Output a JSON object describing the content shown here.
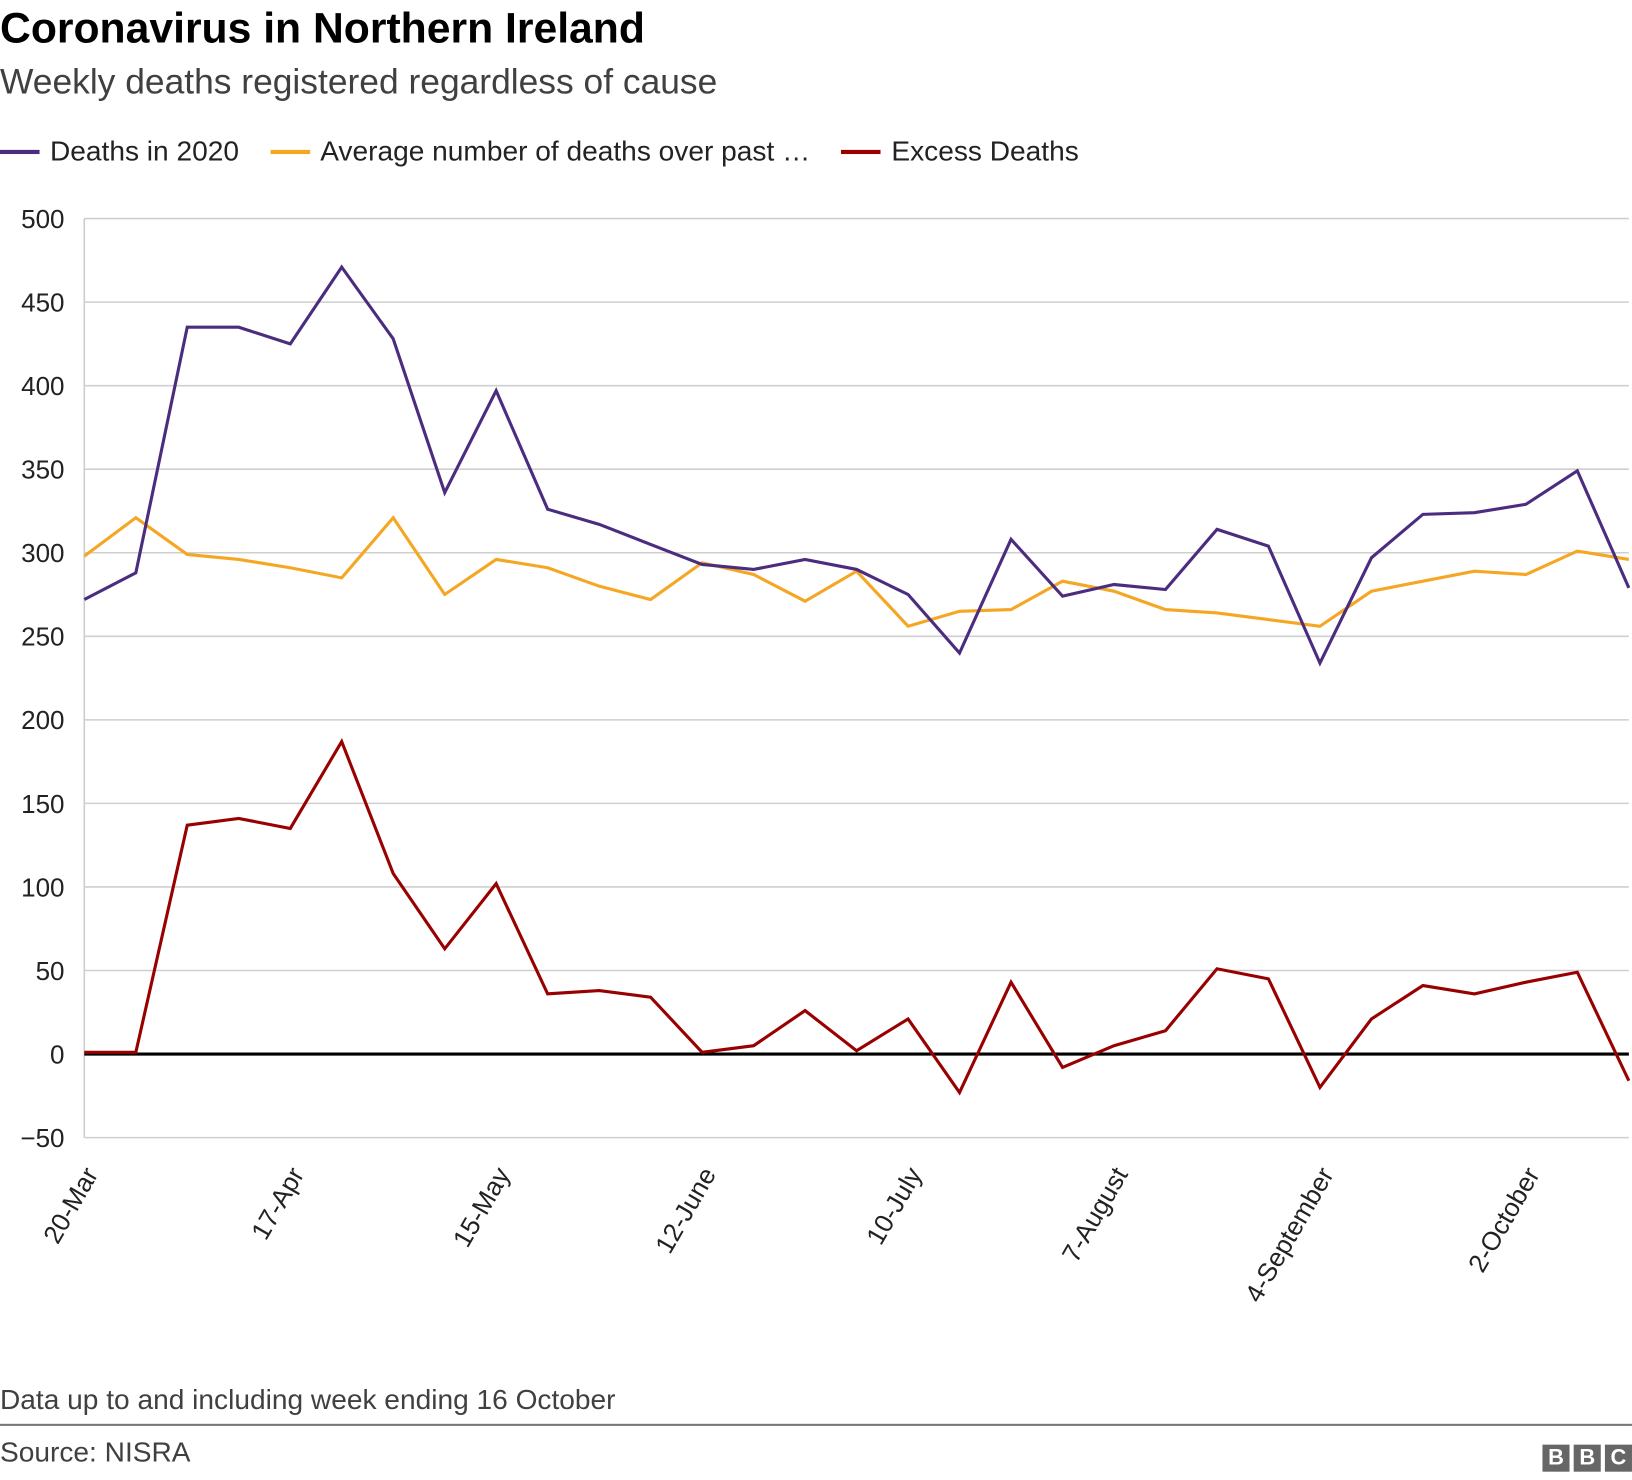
{
  "header": {
    "title": "Coronavirus in Northern Ireland",
    "subtitle": "Weekly deaths registered regardless of cause"
  },
  "footer": {
    "note": "Data up to and including week ending 16 October",
    "source": "Source: NISRA",
    "logo": "BBC"
  },
  "chart_data": {
    "type": "line",
    "title": "Coronavirus in Northern Ireland",
    "subtitle": "Weekly deaths registered regardless of cause",
    "xlabel": "",
    "ylabel": "",
    "ylim": [
      -50,
      500
    ],
    "yticks": [
      500,
      450,
      400,
      350,
      300,
      250,
      200,
      150,
      100,
      50,
      0,
      -50
    ],
    "ytick_labels": [
      "500",
      "450",
      "400",
      "350",
      "300",
      "250",
      "200",
      "150",
      "100",
      "50",
      "0",
      "−50"
    ],
    "grid": true,
    "legend_position": "top-left",
    "x_tick_labels": [
      "20-Mar",
      "17-Apr",
      "15-May",
      "12-June",
      "10-July",
      "7-August",
      "4-September",
      "2-October"
    ],
    "x_tick_every": 4,
    "point_count": 31,
    "series": [
      {
        "name": "Deaths in 2020",
        "color": "#4b2d7f",
        "values": [
          272,
          288,
          435,
          435,
          425,
          471,
          428,
          336,
          397,
          326,
          317,
          305,
          293,
          290,
          296,
          290,
          275,
          240,
          308,
          274,
          281,
          278,
          314,
          304,
          234,
          297,
          323,
          324,
          329,
          349,
          279
        ]
      },
      {
        "name": "Average number of deaths over past …",
        "color": "#f5a623",
        "values": [
          298,
          321,
          299,
          296,
          291,
          285,
          321,
          275,
          296,
          291,
          280,
          272,
          294,
          287,
          271,
          289,
          256,
          265,
          266,
          283,
          277,
          266,
          264,
          260,
          256,
          277,
          283,
          289,
          287,
          301,
          296
        ]
      },
      {
        "name": "Excess Deaths",
        "color": "#990000",
        "values": [
          1,
          1,
          137,
          141,
          135,
          187,
          108,
          63,
          102,
          36,
          38,
          34,
          1,
          5,
          26,
          2,
          21,
          -23,
          43,
          -8,
          5,
          14,
          51,
          45,
          -20,
          21,
          41,
          36,
          43,
          49,
          -16
        ]
      }
    ]
  }
}
